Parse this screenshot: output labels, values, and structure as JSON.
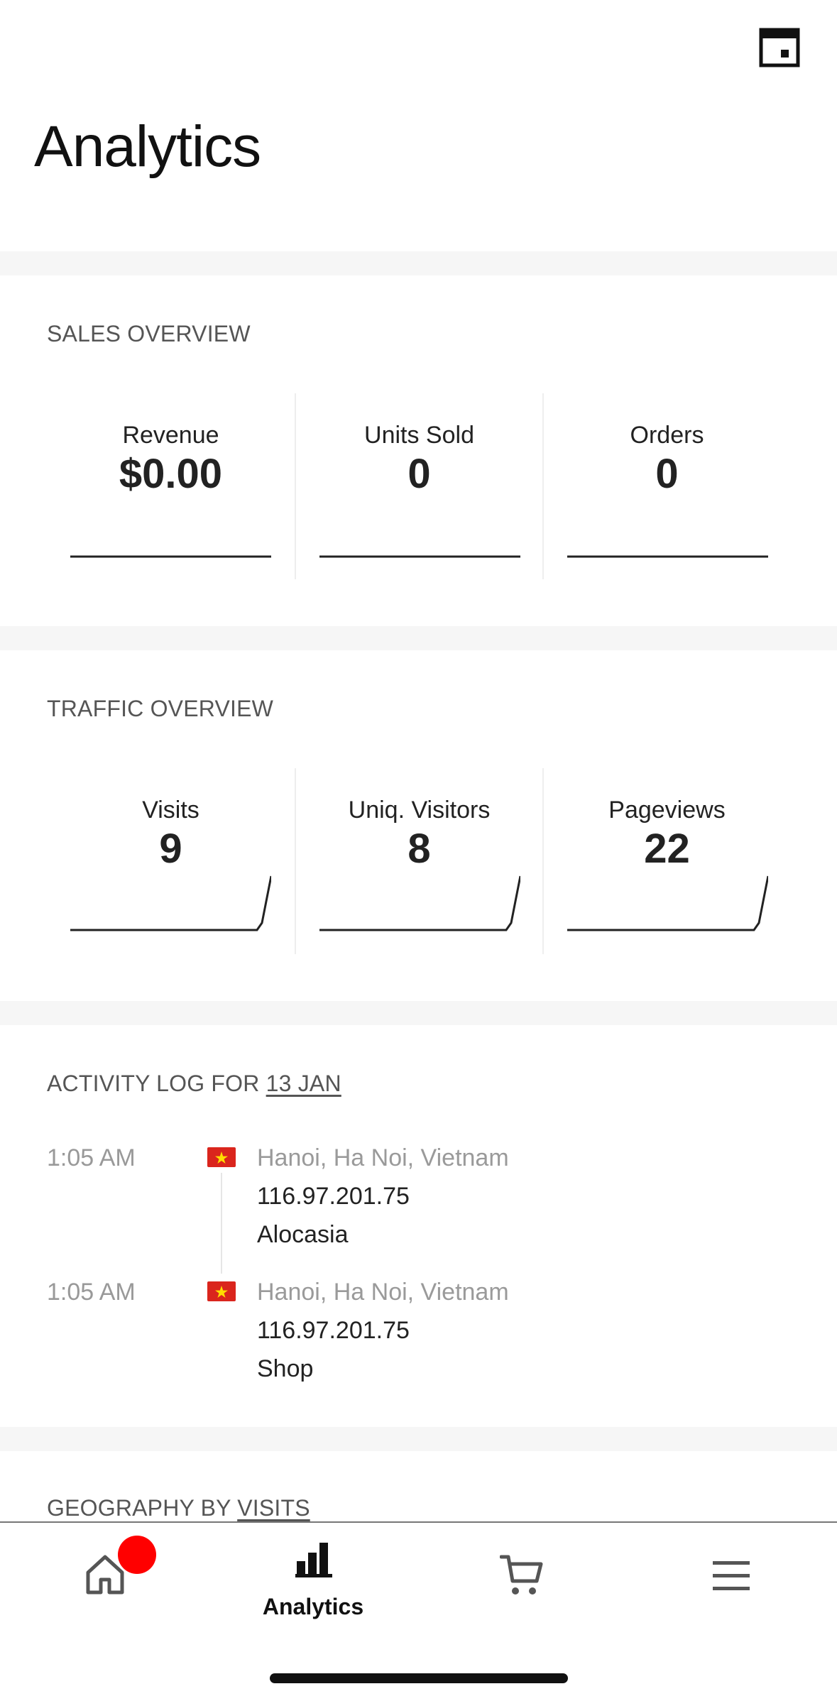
{
  "header": {
    "title": "Analytics",
    "calendar_icon": "calendar-icon"
  },
  "sales": {
    "title": "SALES OVERVIEW",
    "stats": [
      {
        "label": "Revenue",
        "value": "$0.00"
      },
      {
        "label": "Units Sold",
        "value": "0"
      },
      {
        "label": "Orders",
        "value": "0"
      }
    ]
  },
  "traffic": {
    "title": "TRAFFIC OVERVIEW",
    "stats": [
      {
        "label": "Visits",
        "value": "9"
      },
      {
        "label": "Uniq. Visitors",
        "value": "8"
      },
      {
        "label": "Pageviews",
        "value": "22"
      }
    ]
  },
  "activity": {
    "title_prefix": "ACTIVITY LOG FOR ",
    "title_date": "13 JAN",
    "entries": [
      {
        "time": "1:05 AM",
        "location": "Hanoi, Ha Noi, Vietnam",
        "ip": "116.97.201.75",
        "page": "Alocasia",
        "flag_icon": "vietnam-flag-icon"
      },
      {
        "time": "1:05 AM",
        "location": "Hanoi, Ha Noi, Vietnam",
        "ip": "116.97.201.75",
        "page": "Shop",
        "flag_icon": "vietnam-flag-icon"
      }
    ]
  },
  "geo": {
    "title_prefix": "GEOGRAPHY BY ",
    "title_link": "VISITS"
  },
  "tabbar": {
    "tabs": [
      {
        "icon": "home-icon",
        "label": ""
      },
      {
        "icon": "bar-chart-icon",
        "label": "Analytics",
        "active": true
      },
      {
        "icon": "cart-icon",
        "label": ""
      },
      {
        "icon": "menu-icon",
        "label": ""
      }
    ]
  },
  "colors": {
    "accent": "#111111",
    "badge": "#ff0000",
    "section_bg": "#f6f6f6",
    "muted": "#999999"
  }
}
